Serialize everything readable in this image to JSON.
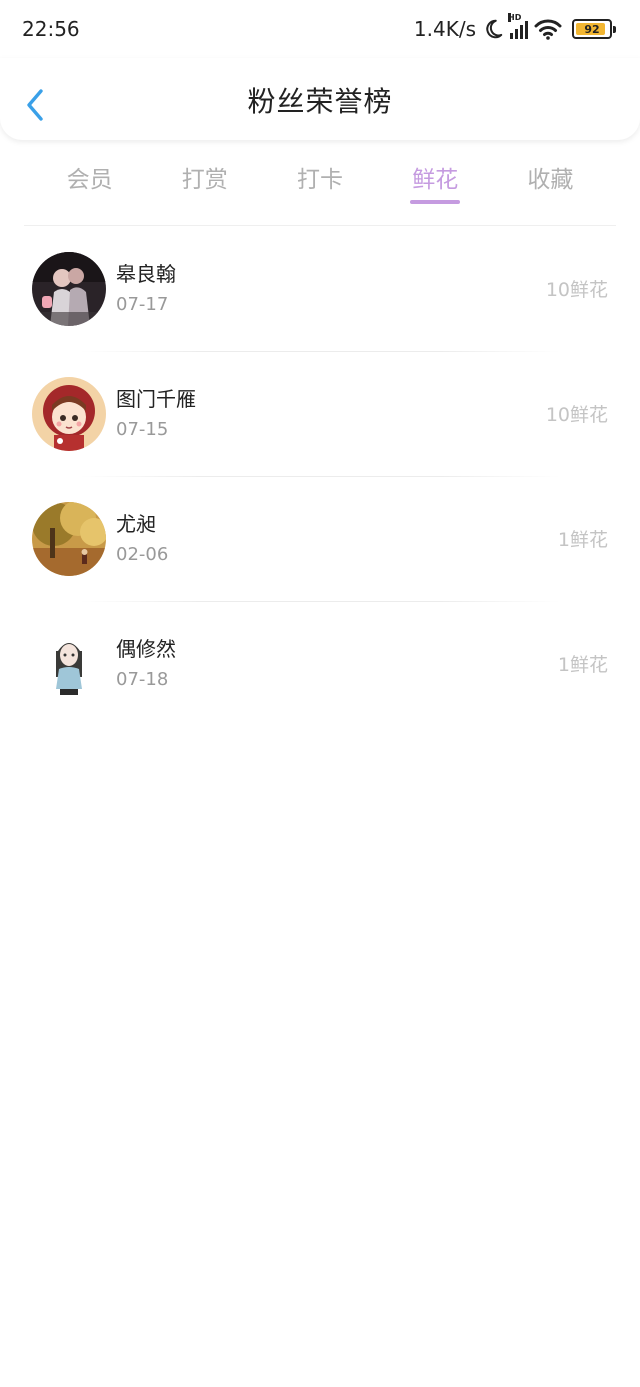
{
  "status_bar": {
    "time": "22:56",
    "network_speed": "1.4K/s",
    "signal_badge": "HD",
    "battery_level": "92",
    "battery_fraction": 0.92
  },
  "header": {
    "title": "粉丝荣誉榜"
  },
  "tabs": [
    {
      "label": "会员"
    },
    {
      "label": "打赏"
    },
    {
      "label": "打卡"
    },
    {
      "label": "鲜花"
    },
    {
      "label": "收藏"
    }
  ],
  "active_tab_index": 3,
  "colors": {
    "accent": "#c59be0",
    "back_arrow": "#3aa0e8",
    "battery_fill": "#f2b632"
  },
  "fans": [
    {
      "name": "皋良翰",
      "date": "07-17",
      "amount": "10鲜花",
      "avatar": "couple-photo-avatar"
    },
    {
      "name": "图门千雁",
      "date": "07-15",
      "amount": "10鲜花",
      "avatar": "cartoon-girl-avatar"
    },
    {
      "name": "尤昶",
      "date": "02-06",
      "amount": "1鲜花",
      "avatar": "autumn-tree-avatar"
    },
    {
      "name": "偶修然",
      "date": "07-18",
      "amount": "1鲜花",
      "avatar": "anime-girl-avatar"
    }
  ]
}
